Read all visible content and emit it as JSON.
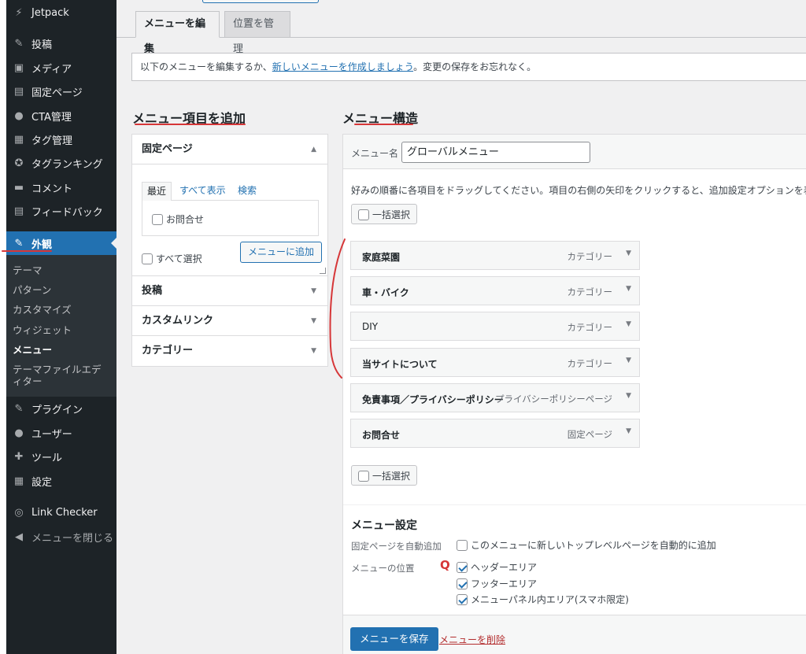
{
  "sidebar": {
    "items": [
      {
        "icon": "⚡",
        "label": "Jetpack"
      },
      {
        "icon": "✎",
        "label": "投稿"
      },
      {
        "icon": "▣",
        "label": "メディア"
      },
      {
        "icon": "▤",
        "label": "固定ページ"
      },
      {
        "icon": "●",
        "label": "CTA管理"
      },
      {
        "icon": "▦",
        "label": "タグ管理"
      },
      {
        "icon": "✪",
        "label": "タグランキング"
      },
      {
        "icon": "▬",
        "label": "コメント"
      },
      {
        "icon": "▤",
        "label": "フィードバック"
      },
      {
        "icon": "✎",
        "label": "外観"
      },
      {
        "icon": "✎",
        "label": "プラグイン"
      },
      {
        "icon": "●",
        "label": "ユーザー"
      },
      {
        "icon": "✚",
        "label": "ツール"
      },
      {
        "icon": "▦",
        "label": "設定"
      },
      {
        "icon": "◎",
        "label": "Link Checker"
      },
      {
        "icon": "◀",
        "label": "メニューを閉じる"
      }
    ],
    "submenu": [
      "テーマ",
      "パターン",
      "カスタマイズ",
      "ウィジェット",
      "メニュー",
      "テーマファイルエディター"
    ]
  },
  "tabs": {
    "edit": "メニューを編集",
    "manage": "位置を管理"
  },
  "notice": {
    "before": "以下のメニューを編集するか、",
    "link": "新しいメニューを作成しましょう",
    "after": "。変更の保存をお忘れなく。"
  },
  "add_items": {
    "heading": "メニュー項目を追加",
    "sections": [
      "固定ページ",
      "投稿",
      "カスタムリンク",
      "カテゴリー"
    ],
    "inner_tabs": [
      "最近",
      "すべて表示",
      "検索"
    ],
    "page_option": "お問合せ",
    "select_all": "すべて選択",
    "add_button": "メニューに追加"
  },
  "structure": {
    "heading": "メニュー構造",
    "name_label": "メニュー名",
    "name_value": "グローバルメニュー",
    "instructions": "好みの順番に各項目をドラッグしてください。項目の右側の矢印をクリックすると、追加設定オプションを表示",
    "bulk_select": "一括選択",
    "items": [
      {
        "title": "家庭菜園",
        "type": "カテゴリー"
      },
      {
        "title": "車・バイク",
        "type": "カテゴリー"
      },
      {
        "title": "DIY",
        "type": "カテゴリー"
      },
      {
        "title": "当サイトについて",
        "type": "カテゴリー"
      },
      {
        "title": "免責事項／プライバシーポリシー",
        "type": "プライバシーポリシーページ"
      },
      {
        "title": "お問合せ",
        "type": "固定ページ"
      }
    ]
  },
  "settings": {
    "title": "メニュー設定",
    "auto_add_label": "固定ページを自動追加",
    "auto_add_option": "このメニューに新しいトップレベルページを自動的に追加",
    "location_label": "メニューの位置",
    "q_mark": "Q",
    "locations": [
      "ヘッダーエリア",
      "フッターエリア",
      "メニューパネル内エリア(スマホ限定)"
    ]
  },
  "footer": {
    "save": "メニューを保存",
    "delete": "メニューを削除"
  }
}
